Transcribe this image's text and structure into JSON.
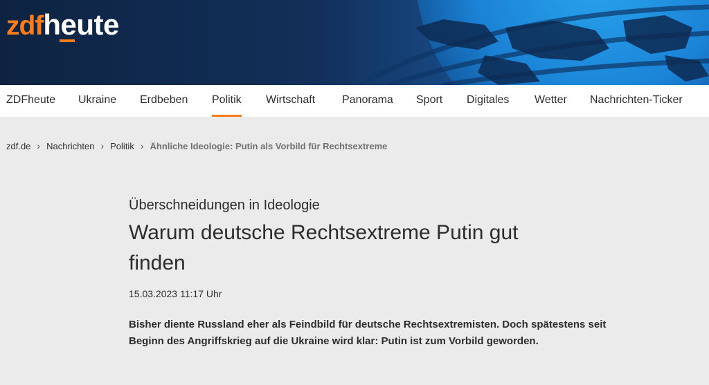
{
  "brand": {
    "logo_zdf": "zdf",
    "logo_heute": "heute",
    "accent_color": "#fa7d19"
  },
  "nav": {
    "items": [
      {
        "label": "ZDFheute"
      },
      {
        "label": "Ukraine"
      },
      {
        "label": "Erdbeben"
      },
      {
        "label": "Politik",
        "active": true
      },
      {
        "label": "Wirtschaft"
      },
      {
        "label": "Panorama"
      },
      {
        "label": "Sport"
      },
      {
        "label": "Digitales"
      },
      {
        "label": "Wetter"
      },
      {
        "label": "Nachrichten-Ticker"
      }
    ]
  },
  "breadcrumb": {
    "items": [
      "zdf.de",
      "Nachrichten",
      "Politik"
    ],
    "current": "Ähnliche Ideologie: Putin als Vorbild für Rechtsextreme",
    "separator_icon": "chevron-right-icon"
  },
  "article": {
    "kicker": "Überschneidungen in Ideologie",
    "title": "Warum deutsche Rechtsextreme Putin gut finden",
    "date": "15.03.2023 11:17 Uhr",
    "lead": "Bisher diente Russland eher als Feindbild für deutsche Rechtsextremisten. Doch spätes­tens seit Beginn des Angriffskrieg auf die Ukraine wird klar: Putin ist zum Vorbild gewor­den."
  }
}
